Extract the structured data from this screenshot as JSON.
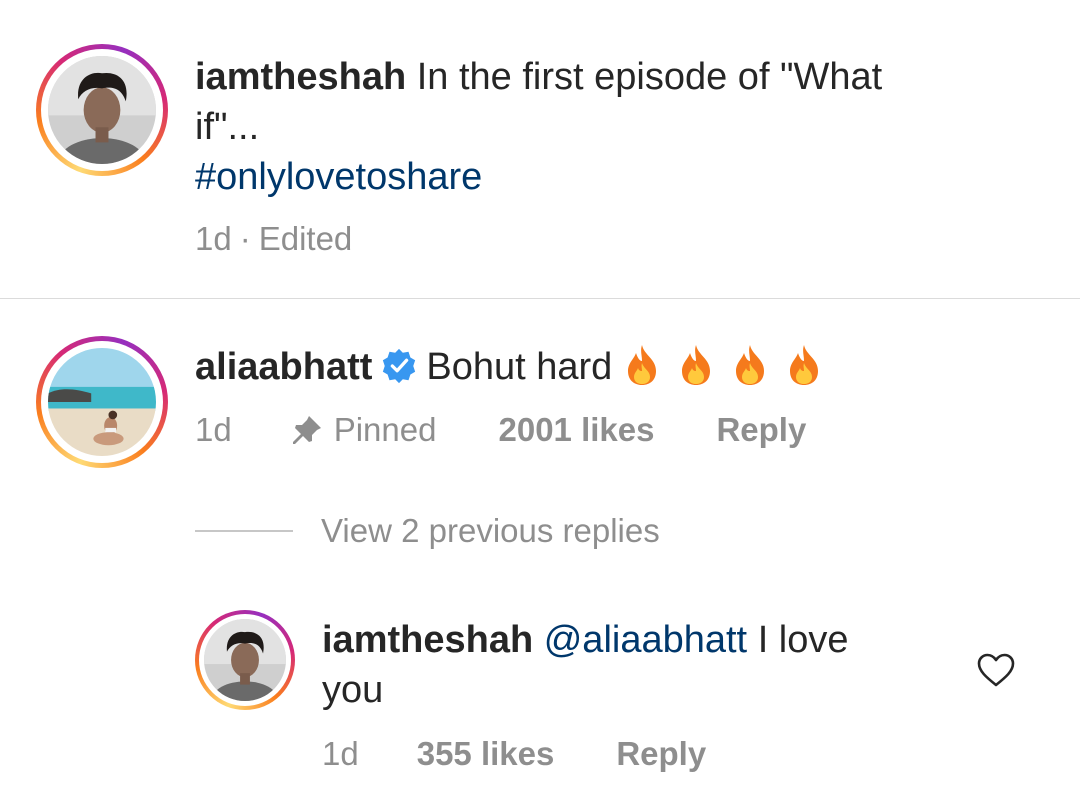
{
  "caption": {
    "username": "iamtheshah",
    "text_line1": "In the first episode of \"What",
    "text_line2": "if\"...",
    "hashtag": "#onlylovetoshare",
    "time": "1d",
    "separator": "·",
    "edited": "Edited",
    "avatar_icon": "profile-photo-man"
  },
  "comment": {
    "username": "aliaabhatt",
    "verified_icon": "verified-badge-icon",
    "text": "Bohut hard",
    "emoji": [
      "🔥",
      "🔥",
      "🔥",
      "🔥"
    ],
    "time": "1d",
    "pinned_icon": "pin-icon",
    "pinned_label": "Pinned",
    "likes": "2001 likes",
    "reply_label": "Reply",
    "avatar_icon": "profile-photo-beach"
  },
  "view_replies": {
    "label": "View 2 previous replies"
  },
  "reply": {
    "username": "iamtheshah",
    "mention": "@aliaabhatt",
    "text_line1": "I love",
    "text_line2": "you",
    "time": "1d",
    "likes": "355 likes",
    "reply_label": "Reply",
    "heart_icon": "heart-outline-icon",
    "avatar_icon": "profile-photo-man"
  },
  "colors": {
    "text": "#262626",
    "secondary": "#8e8e8e",
    "link": "#00376b",
    "verified": "#3897f0",
    "divider": "#dbdbdb"
  }
}
